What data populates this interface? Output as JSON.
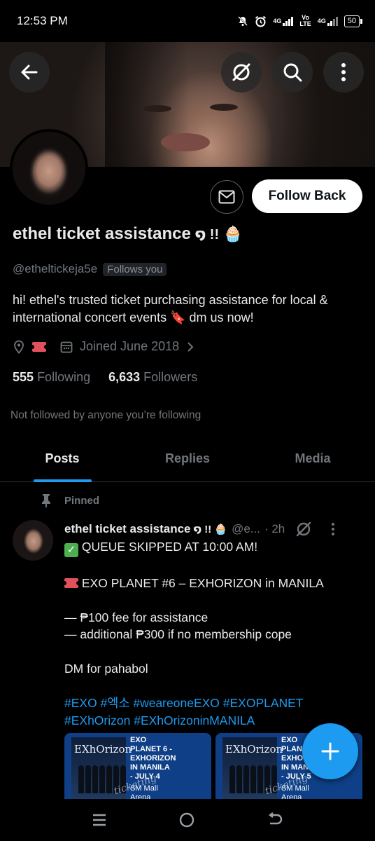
{
  "status_bar": {
    "time": "12:53 PM",
    "net_primary": "4G",
    "net_volte_top": "Vo",
    "net_volte_bottom": "LTE",
    "net_secondary": "4G",
    "battery": "50"
  },
  "profile": {
    "display_name": "ethel ticket assistance",
    "name_suffix": "໑ !!",
    "name_emoji": "🧁",
    "handle": "@etheltickeja5e",
    "follows_you": "Follows you",
    "follow_button": "Follow Back",
    "bio": "hi! ethel's trusted ticket purchasing assistance for local & international concert events 🔖 dm us now!",
    "joined": "Joined June 2018",
    "following_count": "555",
    "following_label": "Following",
    "followers_count": "6,633",
    "followers_label": "Followers",
    "not_followed": "Not followed by anyone you’re following"
  },
  "tabs": [
    "Posts",
    "Replies",
    "Media"
  ],
  "post": {
    "pinned_label": "Pinned",
    "author": "ethel ticket assistance",
    "author_suffix": "໑ !! 🧁",
    "handle": "@e...",
    "time": "· 2h",
    "line1": "QUEUE SKIPPED AT 10:00 AM!",
    "line2": "EXO PLANET #6 – EXHORIZON in MANILA",
    "line3": "— ₱100 fee for assistance",
    "line4": "— additional ₱300 if no membership cope",
    "line5": "DM for pahabol",
    "hashtags_line1": "#EXO #엑소 #weareoneEXO #EXOPLANET",
    "hashtags_line2": "#EXhOrizon #EXhOrizoninMANILA",
    "media": [
      {
        "poster_title": "EXhOrizon",
        "caption_lines": [
          "EXO",
          "PLANET 6 -",
          "EXHORIZON",
          "IN MANILA",
          "- JULY 4",
          "SM Mall",
          "Arena"
        ],
        "watermark": "ticketing"
      },
      {
        "poster_title": "EXhOrizon",
        "caption_lines": [
          "EXO",
          "PLANET 6",
          "EXHOR",
          "IN MAN",
          "- JULY 5",
          "SM Mall",
          "Arena"
        ],
        "watermark": "ticketing"
      }
    ]
  },
  "colors": {
    "accent": "#1d9bf0",
    "background": "#000000",
    "muted": "#71767b",
    "text": "#e7e9ea"
  },
  "icons": [
    "back-arrow-icon",
    "grok-icon",
    "search-icon",
    "more-vertical-icon",
    "mail-icon",
    "location-icon",
    "calendar-icon",
    "chevron-right-icon",
    "pin-icon",
    "compose-plus-icon",
    "recents-nav-icon",
    "home-nav-icon",
    "back-nav-icon"
  ]
}
